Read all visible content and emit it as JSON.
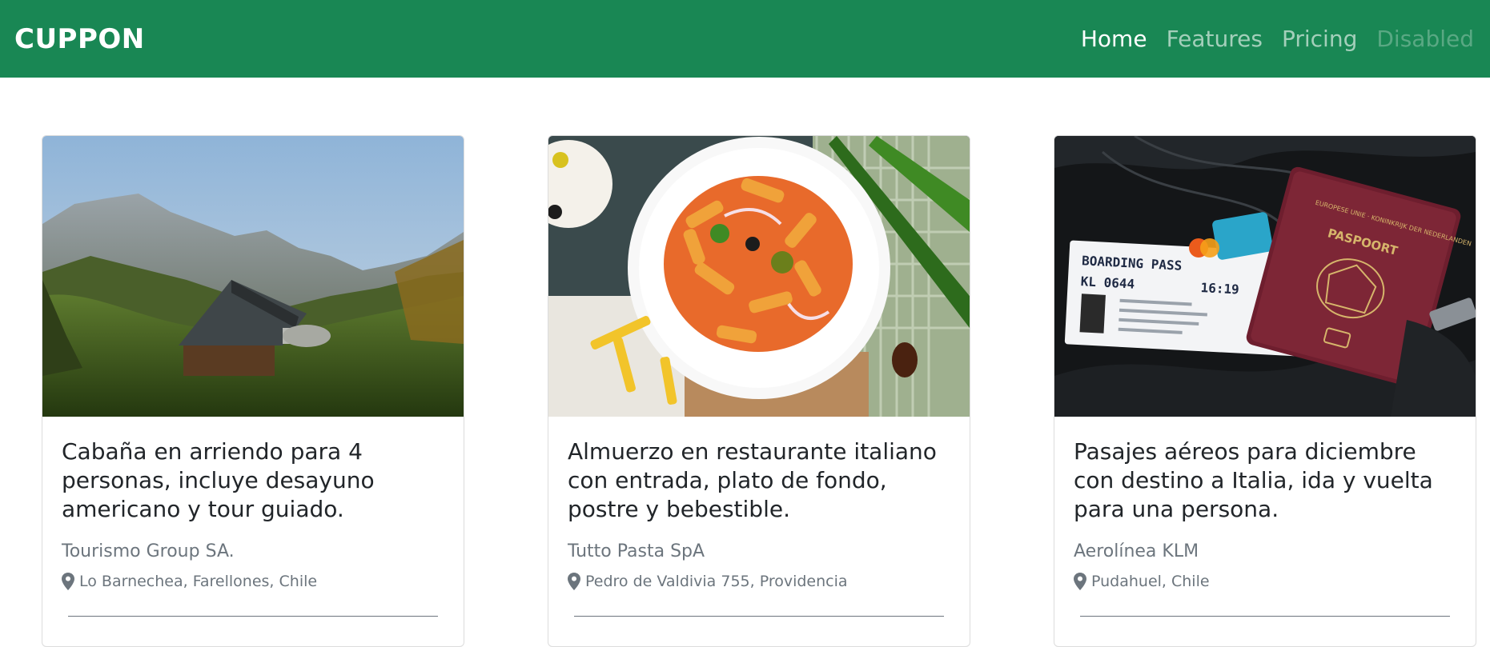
{
  "navbar": {
    "brand": "CUPPON",
    "links": [
      {
        "label": "Home"
      },
      {
        "label": "Features"
      },
      {
        "label": "Pricing"
      },
      {
        "label": "Disabled"
      }
    ]
  },
  "cards": [
    {
      "title": "Cabaña en arriendo para 4 personas, incluye desayuno americano y tour guiado.",
      "company": "Tourismo Group SA.",
      "location": "Lo Barnechea, Farellones, Chile",
      "image": "mountain-cabin-photo"
    },
    {
      "title": "Almuerzo en restaurante italiano con entrada, plato de fondo, postre y bebestible.",
      "company": "Tutto Pasta SpA",
      "location": "Pedro de Valdivia 755, Providencia",
      "image": "pasta-plate-photo"
    },
    {
      "title": "Pasajes aéreos para diciembre con destino a Italia, ida y vuelta para una persona.",
      "company": "Aerolínea KLM",
      "location": "Pudahuel, Chile",
      "image": "passport-boarding-pass-photo",
      "photo_text": {
        "boarding_title": "BOARDING PASS",
        "flight": "KL  0644",
        "time": "16:19",
        "passport_title": "PASPOORT",
        "passport_country": "EUROPESE UNIE · KONINKRIJK DER NEDERLANDEN"
      }
    }
  ],
  "colors": {
    "navbar_bg": "#198754",
    "muted_text": "#6c757d"
  },
  "icons": {
    "location": "map-pin-icon"
  }
}
